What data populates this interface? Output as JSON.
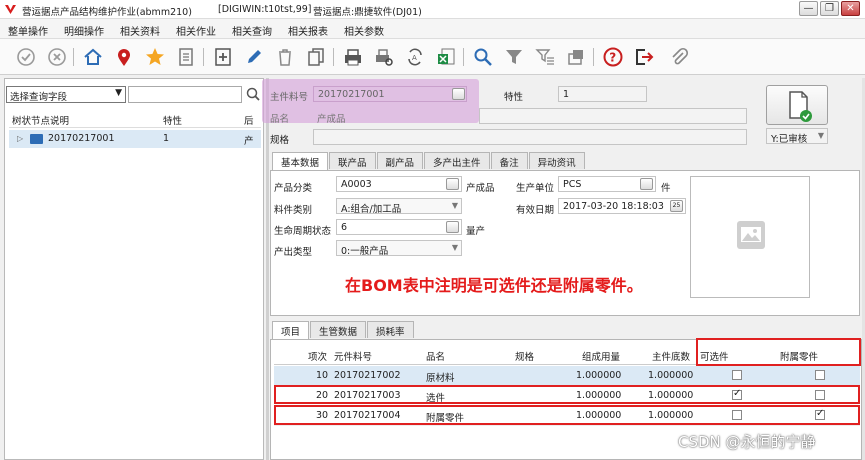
{
  "window": {
    "title": "营运据点产品结构维护作业(abmm210)",
    "db": "[DIGIWIN:t10tst,99]",
    "site": "营运据点:鼎捷软件(DJ01)",
    "minimize": "—",
    "restore": "❐",
    "close": "✕"
  },
  "menu": [
    "整单操作",
    "明细操作",
    "相关资料",
    "相关作业",
    "相关查询",
    "相关报表",
    "相关参数"
  ],
  "toolbar": [
    "approve-icon",
    "cancel-icon",
    "home-icon",
    "location-icon",
    "favorite-icon",
    "list-icon",
    "add-icon",
    "edit-icon",
    "delete-icon",
    "copy-icon",
    "print-icon",
    "print-preview-icon",
    "export-icon",
    "excel-icon",
    "search-icon",
    "filter-icon",
    "advanced-filter-icon",
    "docs-icon",
    "help-icon",
    "exit-icon",
    "attachment-icon"
  ],
  "left": {
    "query_select": "选择查询字段",
    "tree_headers": [
      "树状节点说明",
      "特性",
      "后"
    ],
    "tree_rows": [
      {
        "label": "20170217001",
        "feature": "1",
        "extra": "产"
      }
    ]
  },
  "header": {
    "item_label": "主件料号",
    "item_value": "20170217001",
    "name_label": "品名",
    "name_value": "产成品",
    "spec_label": "规格",
    "feature_label": "特性",
    "feature_value": "1",
    "status_value": "Y:已审核"
  },
  "tabs_top": [
    "基本数据",
    "联产品",
    "副产品",
    "多产出主件",
    "备注",
    "异动资讯"
  ],
  "basic": {
    "category_label": "产品分类",
    "category_value": "A0003",
    "category_name": "产成品",
    "unit_label": "生产单位",
    "unit_value": "PCS",
    "unit_name": "件",
    "type_label": "料件类别",
    "type_value": "A:组合/加工品",
    "date_label": "有效日期",
    "date_value": "2017-03-20 18:18:03",
    "lifecycle_label": "生命周期状态",
    "lifecycle_value": "6",
    "lifecycle_name": "量产",
    "output_label": "产出类型",
    "output_value": "0:一般产品"
  },
  "annotation": "在BOM表中注明是可选件还是附属零件。",
  "tabs_bottom": [
    "项目",
    "生管数据",
    "损耗率"
  ],
  "grid": {
    "headers": [
      "项次",
      "元件料号",
      "品名",
      "规格",
      "组成用量",
      "主件底数",
      "可选件",
      "附属零件"
    ],
    "rows": [
      {
        "seq": "10",
        "item": "20170217002",
        "name": "原材料",
        "spec": "",
        "qty": "1.000000",
        "base": "1.000000",
        "optional": false,
        "attached": false
      },
      {
        "seq": "20",
        "item": "20170217003",
        "name": "选件",
        "spec": "",
        "qty": "1.000000",
        "base": "1.000000",
        "optional": true,
        "attached": false
      },
      {
        "seq": "30",
        "item": "20170217004",
        "name": "附属零件",
        "spec": "",
        "qty": "1.000000",
        "base": "1.000000",
        "optional": false,
        "attached": true
      }
    ]
  },
  "watermark": "CSDN @永恒的宁静",
  "colors": {
    "accent": "#2d6cb5",
    "annotation": "#e41b1b",
    "highlight": "#d6a0da",
    "selection": "#dbe9f5"
  }
}
